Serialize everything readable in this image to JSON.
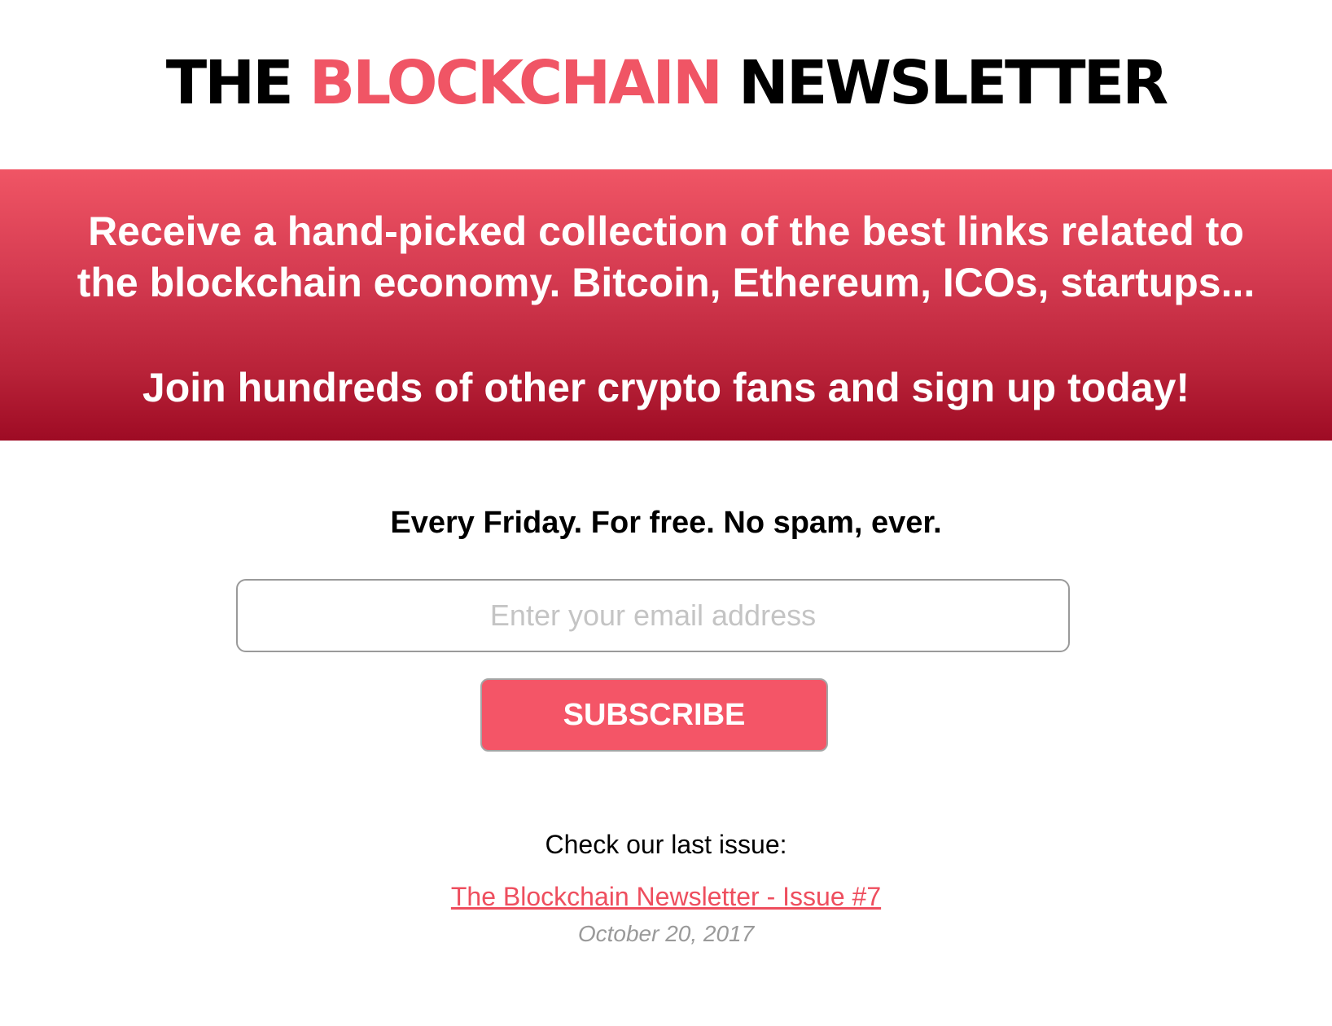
{
  "logo": {
    "part1": "THE",
    "part2": "BLOCKCHAIN",
    "part3": "NEWSLETTER",
    "accent_color": "#f05565",
    "text_color": "#000000"
  },
  "banner": {
    "line1": "Receive a hand-picked collection of the best links related to",
    "line2": "the blockchain economy. Bitcoin, Ethereum, ICOs, startups...",
    "line3": "Join hundreds of other crypto fans and sign up today!",
    "gradient_top": "#f05565",
    "gradient_bottom": "#9e0b24"
  },
  "signup": {
    "tagline": "Every Friday. For free. No spam, ever.",
    "email_placeholder": "Enter your email address",
    "email_value": "",
    "subscribe_label": "SUBSCRIBE",
    "button_color": "#f45567"
  },
  "last_issue": {
    "label": "Check our last issue:",
    "link_text": "The Blockchain Newsletter - Issue #7",
    "date": "October 20, 2017",
    "link_color": "#ee4e5e"
  }
}
